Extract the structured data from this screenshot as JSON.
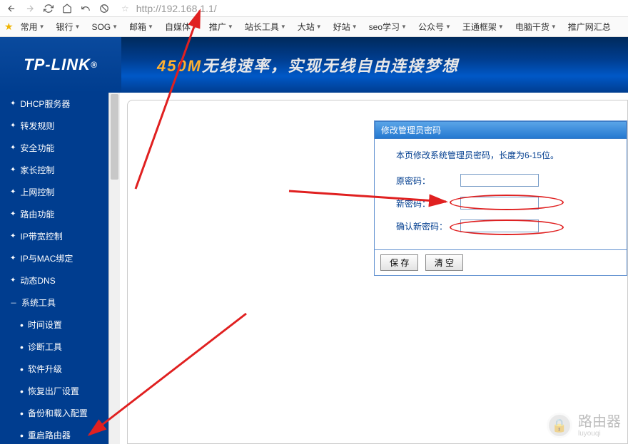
{
  "browser": {
    "url": "http://192.168.1.1/"
  },
  "bookmarks": [
    {
      "label": "常用"
    },
    {
      "label": "银行"
    },
    {
      "label": "SOG"
    },
    {
      "label": "邮箱"
    },
    {
      "label": "自媒体"
    },
    {
      "label": "推广"
    },
    {
      "label": "站长工具"
    },
    {
      "label": "大站"
    },
    {
      "label": "好站"
    },
    {
      "label": "seo学习"
    },
    {
      "label": "公众号"
    },
    {
      "label": "王通框架"
    },
    {
      "label": "电脑干货"
    },
    {
      "label": "推广网汇总"
    }
  ],
  "logo": "TP-LINK",
  "banner": {
    "speed": "450M",
    "text1": "无线速率，",
    "text2": "实现无线自由连接梦想"
  },
  "sidebar": {
    "items": [
      {
        "label": "DHCP服务器",
        "type": "main"
      },
      {
        "label": "转发规则",
        "type": "main"
      },
      {
        "label": "安全功能",
        "type": "main"
      },
      {
        "label": "家长控制",
        "type": "main"
      },
      {
        "label": "上网控制",
        "type": "main"
      },
      {
        "label": "路由功能",
        "type": "main"
      },
      {
        "label": "IP带宽控制",
        "type": "main"
      },
      {
        "label": "IP与MAC绑定",
        "type": "main"
      },
      {
        "label": "动态DNS",
        "type": "main"
      },
      {
        "label": "系统工具",
        "type": "main-open"
      },
      {
        "label": "时间设置",
        "type": "sub"
      },
      {
        "label": "诊断工具",
        "type": "sub"
      },
      {
        "label": "软件升级",
        "type": "sub"
      },
      {
        "label": "恢复出厂设置",
        "type": "sub"
      },
      {
        "label": "备份和载入配置",
        "type": "sub"
      },
      {
        "label": "重启路由器",
        "type": "sub"
      }
    ]
  },
  "panel": {
    "title": "修改管理员密码",
    "desc": "本页修改系统管理员密码，长度为6-15位。",
    "fields": {
      "old": "原密码：",
      "new": "新密码：",
      "confirm": "确认新密码："
    },
    "buttons": {
      "save": "保 存",
      "clear": "清 空"
    }
  },
  "watermark": {
    "main": "路由器",
    "sub": "luyouqi"
  }
}
